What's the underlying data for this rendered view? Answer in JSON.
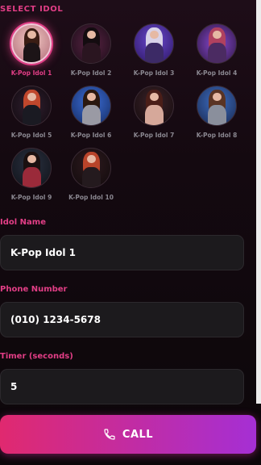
{
  "section_title": "SELECT IDOL",
  "idols": [
    {
      "name": "K-Pop Idol 1",
      "selected": true
    },
    {
      "name": "K-Pop Idol 2",
      "selected": false
    },
    {
      "name": "K-Pop Idol 3",
      "selected": false
    },
    {
      "name": "K-Pop Idol 4",
      "selected": false
    },
    {
      "name": "K-Pop Idol 5",
      "selected": false
    },
    {
      "name": "K-Pop Idol 6",
      "selected": false
    },
    {
      "name": "K-Pop Idol 7",
      "selected": false
    },
    {
      "name": "K-Pop Idol 8",
      "selected": false
    },
    {
      "name": "K-Pop Idol 9",
      "selected": false
    },
    {
      "name": "K-Pop Idol 10",
      "selected": false
    }
  ],
  "form": {
    "idol_name_label": "Idol Name",
    "idol_name_value": "K-Pop Idol 1",
    "phone_label": "Phone Number",
    "phone_value": "(010) 1234-5678",
    "timer_label": "Timer (seconds)",
    "timer_value": "5"
  },
  "call_button": {
    "label": "CALL",
    "icon": "phone-icon"
  },
  "colors": {
    "accent": "#e23e86",
    "gradient_start": "#e0296f",
    "gradient_end": "#a52fd4",
    "field_bg": "#1c1a1d"
  }
}
